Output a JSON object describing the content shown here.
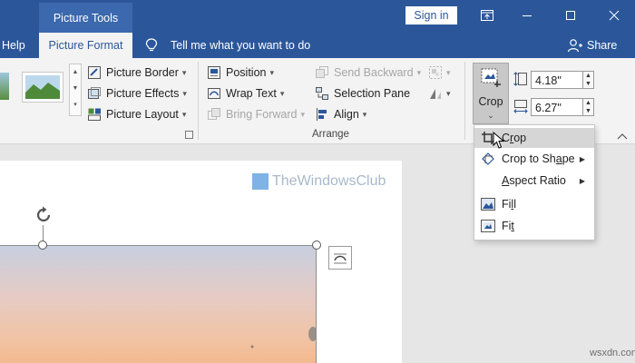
{
  "titlebar": {
    "context_tab": "Picture Tools",
    "signin": "Sign in",
    "ribbon_display_icon": "ribbon-display-icon",
    "minimize_icon": "minimize-icon",
    "restore_icon": "restore-icon",
    "close_icon": "close-icon"
  },
  "tabs": {
    "help": "Help",
    "picture_format": "Picture Format",
    "tell_me": "Tell me what you want to do",
    "share": "Share"
  },
  "ribbon": {
    "picture_border": "Picture Border",
    "picture_effects": "Picture Effects",
    "picture_layout": "Picture Layout",
    "position": "Position",
    "wrap_text": "Wrap Text",
    "bring_forward": "Bring Forward",
    "send_backward": "Send Backward",
    "selection_pane": "Selection Pane",
    "align": "Align",
    "arrange_group": "Arrange",
    "crop": "Crop",
    "height_value": "4.18\"",
    "width_value": "6.27\""
  },
  "crop_menu": {
    "crop": "Crop",
    "crop_to_shape": "Crop to Shape",
    "aspect_ratio": "Aspect Ratio",
    "fill": "Fill",
    "fit": "Fit"
  },
  "document": {
    "watermark": "TheWindowsClub"
  },
  "footer": {
    "site": "wsxdn.com"
  },
  "colors": {
    "ribbon_blue": "#2b579a",
    "menu_highlight": "#d6d6d6",
    "crop_button_bg": "#c8c8c8"
  }
}
